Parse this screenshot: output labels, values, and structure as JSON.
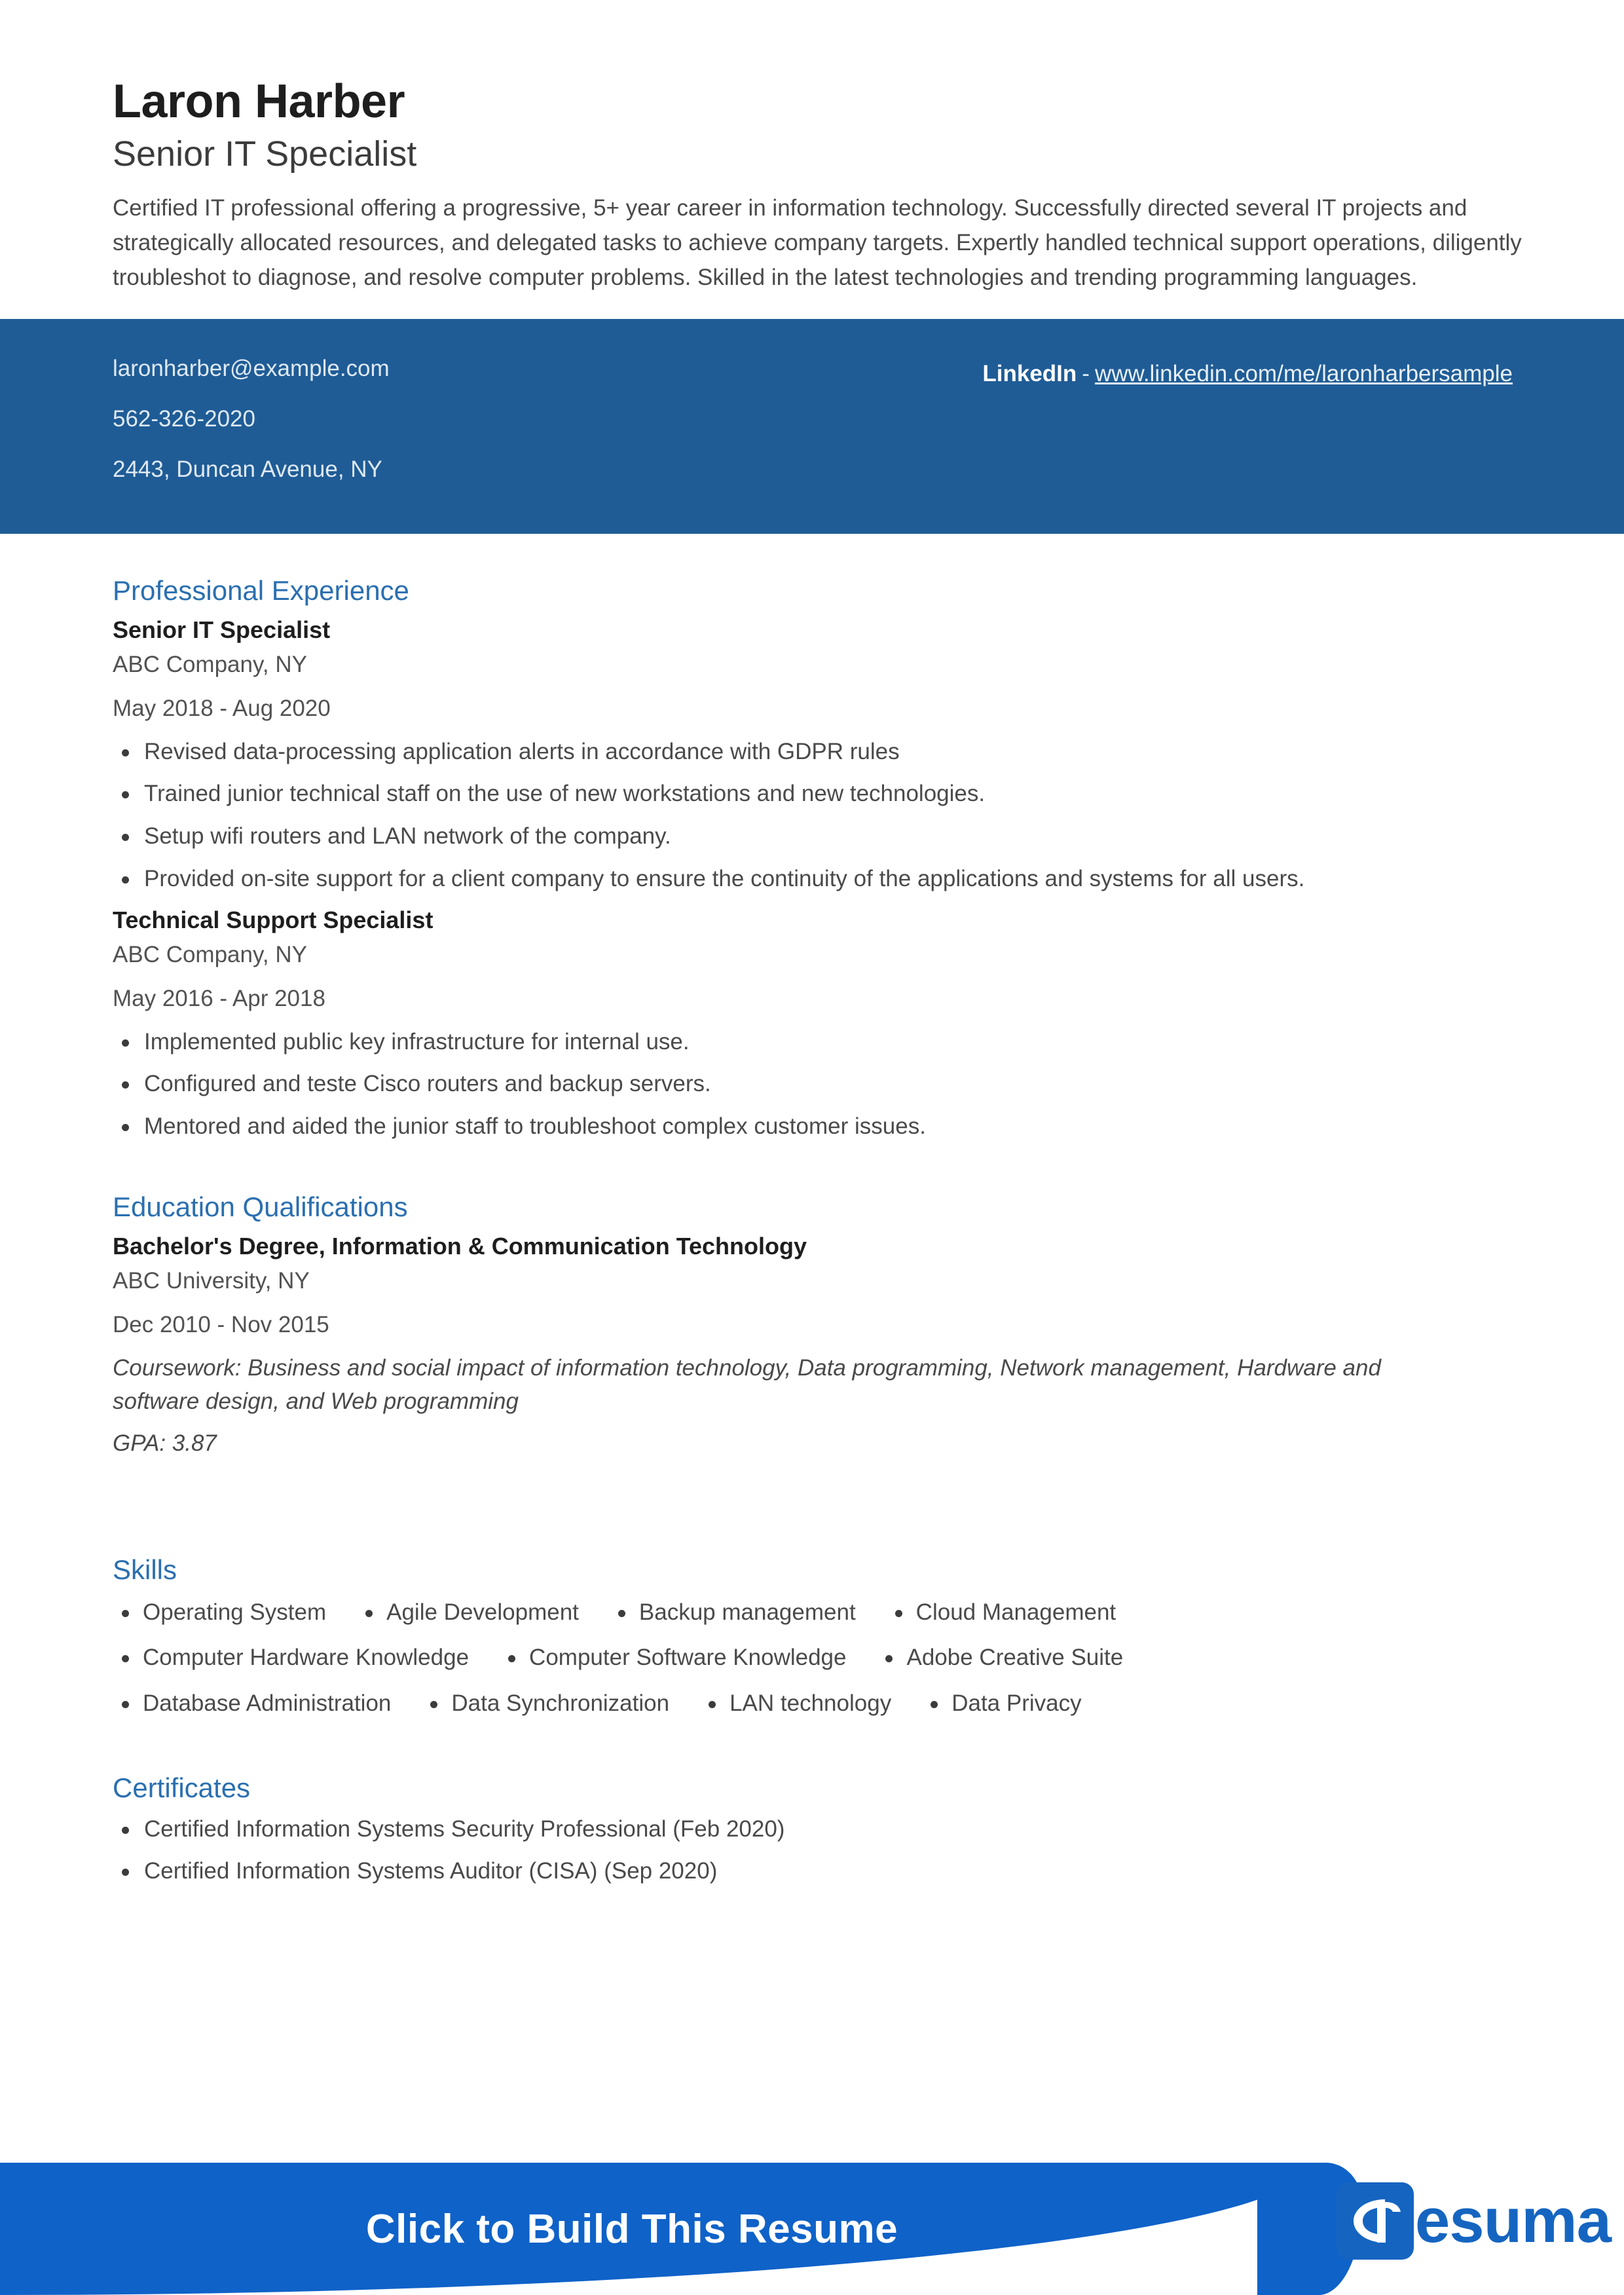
{
  "header": {
    "name": "Laron Harber",
    "job_title": "Senior IT Specialist",
    "summary": "Certified IT professional offering a progressive, 5+ year career in information technology. Successfully directed several IT projects and strategically allocated resources, and delegated tasks to achieve company targets. Expertly handled technical support operations, diligently troubleshot to diagnose, and resolve computer problems. Skilled in the latest technologies and trending programming languages."
  },
  "contact": {
    "email": "laronharber@example.com",
    "phone": "562-326-2020",
    "address": "2443, Duncan Avenue, NY",
    "linkedin_label": "LinkedIn",
    "separator": "-",
    "linkedin_url": "www.linkedin.com/me/laronharbersample",
    "bar_color": "#1f5c96"
  },
  "sections": {
    "experience": {
      "title": "Professional Experience",
      "entries": [
        {
          "role": "Senior IT Specialist",
          "company": "ABC Company, NY",
          "dates": "May 2018 - Aug 2020",
          "bullets": [
            "Revised data-processing application alerts in accordance with GDPR rules",
            "Trained junior technical staff on the use of new workstations and new technologies.",
            "Setup wifi routers and LAN network of the company.",
            "Provided on-site support for a client company to ensure the continuity of the applications and systems for all users."
          ]
        },
        {
          "role": "Technical Support Specialist",
          "company": "ABC Company, NY",
          "dates": "May 2016 - Apr 2018",
          "bullets": [
            "Implemented public key infrastructure for internal use.",
            "Configured and teste Cisco routers and backup servers.",
            "Mentored and aided the junior staff to troubleshoot complex customer issues."
          ]
        }
      ]
    },
    "education": {
      "title": "Education Qualifications",
      "degree": "Bachelor's Degree, Information & Communication Technology",
      "school": "ABC University, NY",
      "dates": "Dec 2010 - Nov 2015",
      "coursework": "Coursework: Business and social impact of information technology, Data programming, Network management, Hardware and software design, and Web programming",
      "gpa": "GPA: 3.87"
    },
    "skills": {
      "title": "Skills",
      "rows": [
        [
          "Operating System",
          "Agile Development",
          "Backup management",
          "Cloud Management"
        ],
        [
          "Computer Hardware Knowledge",
          "Computer Software Knowledge",
          "Adobe Creative Suite"
        ],
        [
          "Database Administration",
          "Data Synchronization",
          "LAN technology",
          "Data Privacy"
        ]
      ]
    },
    "certificates": {
      "title": "Certificates",
      "items": [
        "Certified Information Systems Security Professional  (Feb 2020)",
        "Certified Information Systems Auditor (CISA)  (Sep 2020)"
      ]
    }
  },
  "footer": {
    "cta_label": "Click to Build This Resume",
    "logo_word": "esuma",
    "logo_mark_text": "Cr",
    "band_color": "#0f62c8",
    "logo_color": "#1565c0"
  },
  "theme": {
    "heading_color": "#2a6fb0",
    "text_color": "#4a4a4a"
  }
}
